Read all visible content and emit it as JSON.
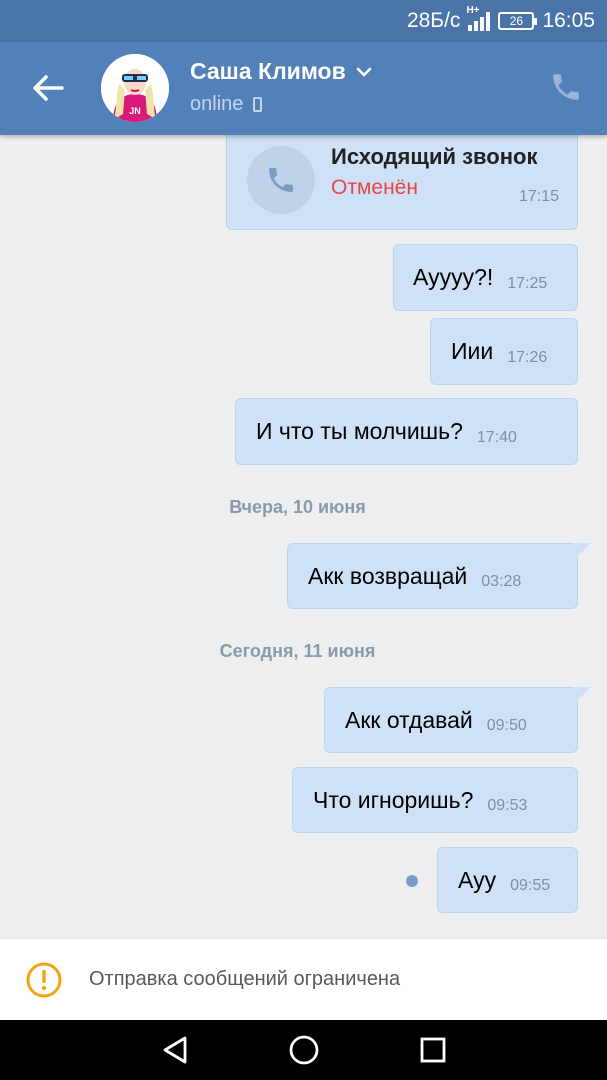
{
  "status_bar": {
    "speed": "28Б/с",
    "network": "H+",
    "battery": "26",
    "time": "16:05"
  },
  "header": {
    "contact_name": "Саша Климов",
    "status": "online",
    "avatar_badge": "JN"
  },
  "call": {
    "title": "Исходящий звонок",
    "status": "Отменён",
    "time": "17:15"
  },
  "messages": [
    {
      "text": "Ауууу?!",
      "time": "17:25"
    },
    {
      "text": "Иии",
      "time": "17:26"
    },
    {
      "text": "И что ты молчишь?",
      "time": "17:40"
    },
    {
      "text": "Акк возвращай",
      "time": "03:28"
    },
    {
      "text": "Акк отдавай",
      "time": "09:50"
    },
    {
      "text": "Что игноришь?",
      "time": "09:53"
    },
    {
      "text": "Ауу",
      "time": "09:55"
    }
  ],
  "date_separators": [
    "Вчера, 10 июня",
    "Сегодня, 11 июня"
  ],
  "restriction": {
    "text": "Отправка сообщений ограничена"
  },
  "colors": {
    "header": "#5181b8",
    "status_bar": "#4a74a8",
    "bubble": "#cfe1f6",
    "cancelled": "#e64646",
    "warning": "#f2a310"
  },
  "icons": {
    "back": "arrow-left-icon",
    "dropdown": "chevron-down-icon",
    "device": "mobile-phone-icon",
    "call": "phone-icon",
    "warning": "exclamation-circle-icon",
    "nav_back": "triangle-back-icon",
    "nav_home": "circle-home-icon",
    "nav_recent": "square-recent-icon"
  }
}
